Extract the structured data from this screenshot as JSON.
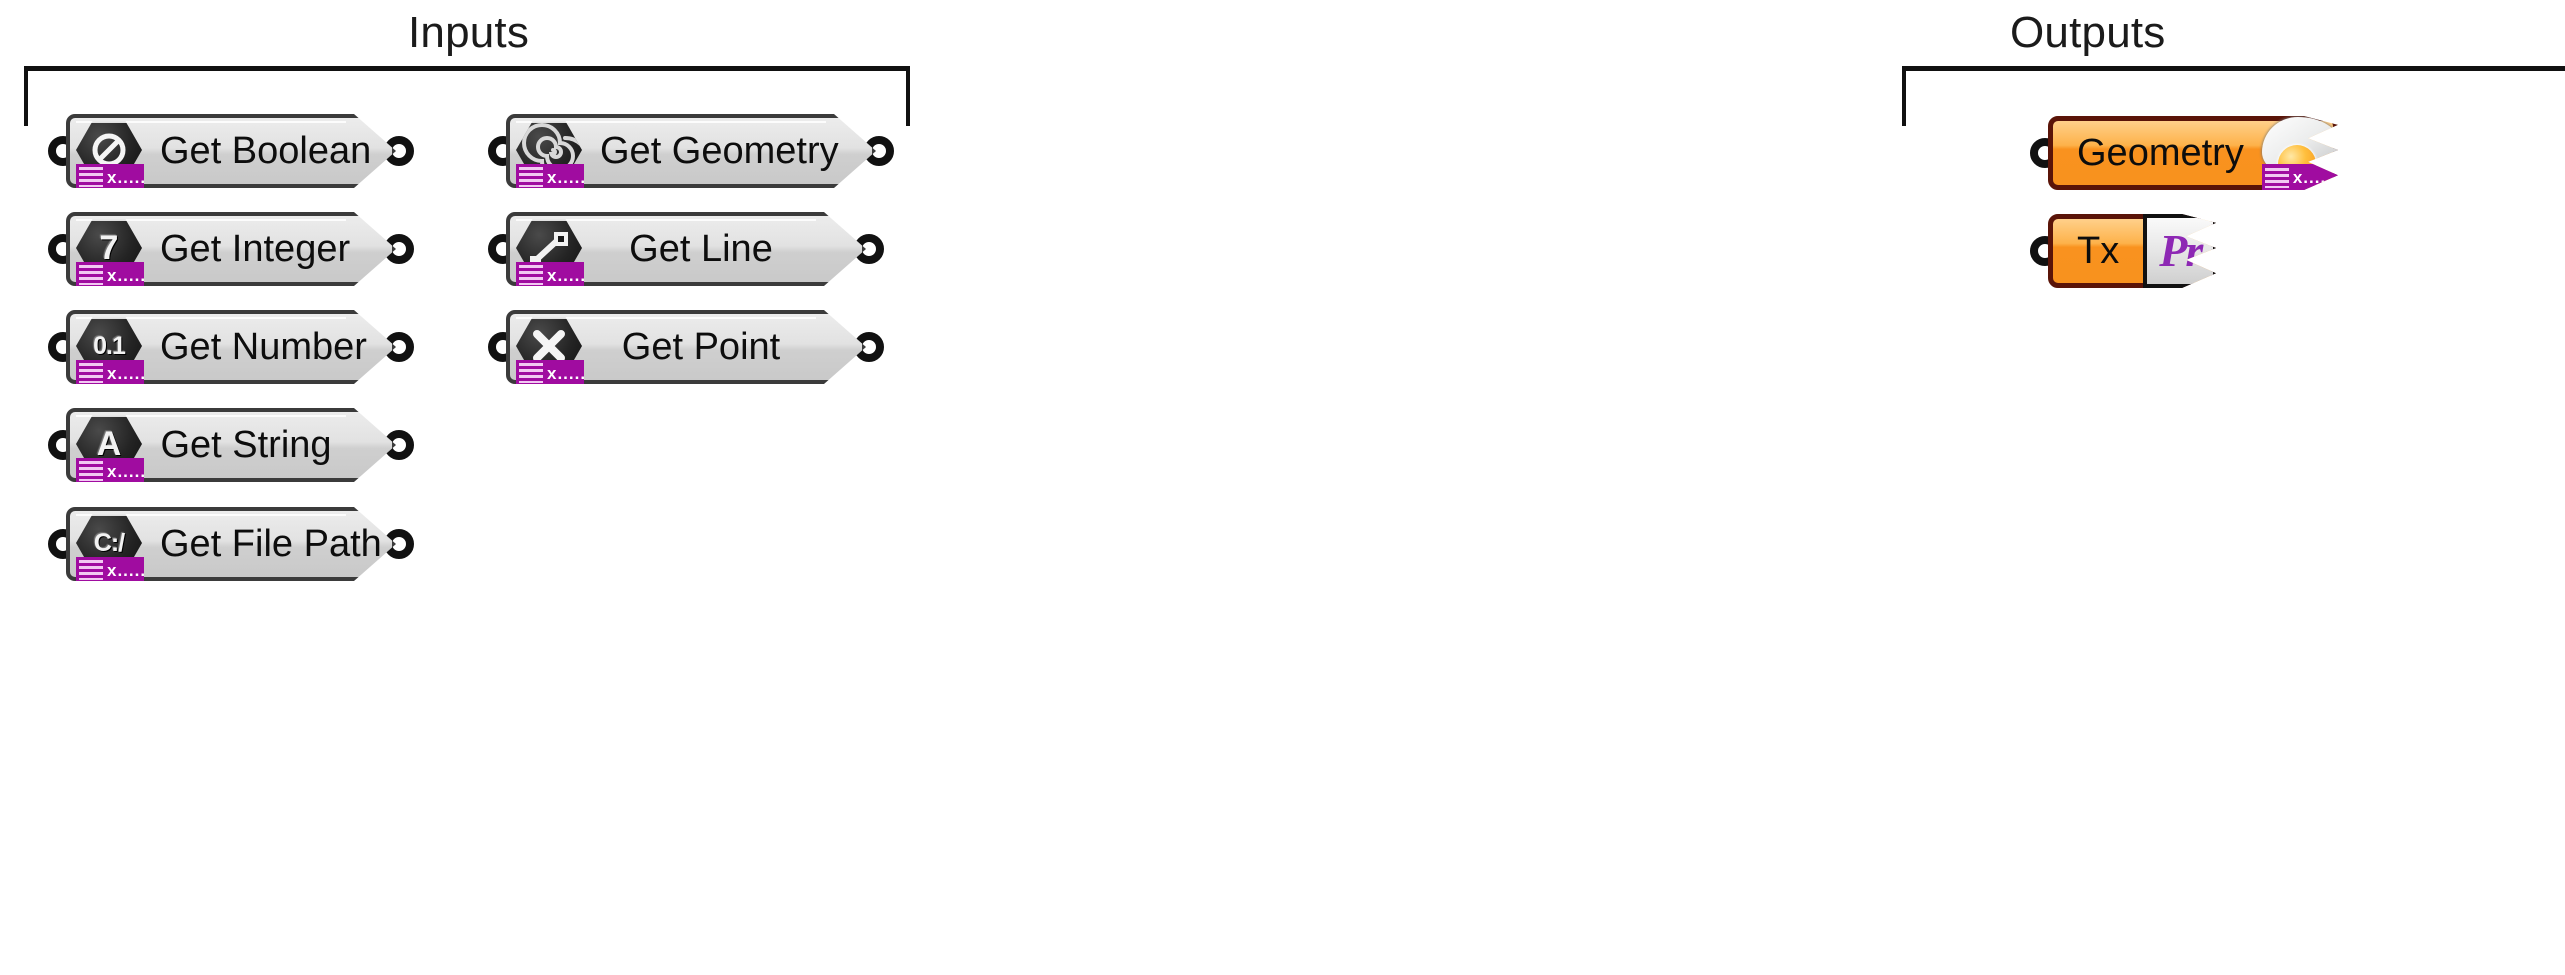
{
  "groups": {
    "inputs": {
      "title": "Inputs"
    },
    "outputs": {
      "title": "Outputs"
    }
  },
  "colors": {
    "node_grey_light": "#ececec",
    "node_grey_dark": "#c9c9c9",
    "node_border": "#3b3b3b",
    "output_orange": "#f8921e",
    "output_orange_light": "#ffd08a",
    "output_border": "#5a1408",
    "persistent_purple": "#a00ca0",
    "premiere_purple": "#8d28b4",
    "text": "#0d0d0d",
    "bracket": "#111111",
    "canvas": "#ffffff"
  },
  "inputs": {
    "column_left": [
      {
        "label": "Get Boolean",
        "icon": "boolean-toggle-icon",
        "glyph": "◐",
        "strip": "x....."
      },
      {
        "label": "Get Integer",
        "icon": "integer-seven-icon",
        "glyph": "7",
        "strip": "x....."
      },
      {
        "label": "Get Number",
        "icon": "number-zero-one-icon",
        "glyph": "0.1",
        "strip": "x....."
      },
      {
        "label": "Get String",
        "icon": "string-letter-a-icon",
        "glyph": "A",
        "strip": "x....."
      },
      {
        "label": "Get File Path",
        "icon": "file-path-drive-icon",
        "glyph": "C:/",
        "strip": "x....."
      }
    ],
    "column_right": [
      {
        "label": "Get Geometry",
        "icon": "geometry-spiral-icon",
        "glyph": "",
        "strip": "x....."
      },
      {
        "label": "Get Line",
        "icon": "line-segment-icon",
        "glyph": "",
        "strip": "x....."
      },
      {
        "label": "Get Point",
        "icon": "point-cross-icon",
        "glyph": "✕",
        "strip": "x....."
      }
    ]
  },
  "outputs": {
    "items": [
      {
        "label": "Geometry",
        "icon": "geometry-blob-icon",
        "strip": "x....."
      },
      {
        "label": "Tx",
        "icon": "premiere-pr-icon",
        "badge": "Pr"
      }
    ]
  }
}
